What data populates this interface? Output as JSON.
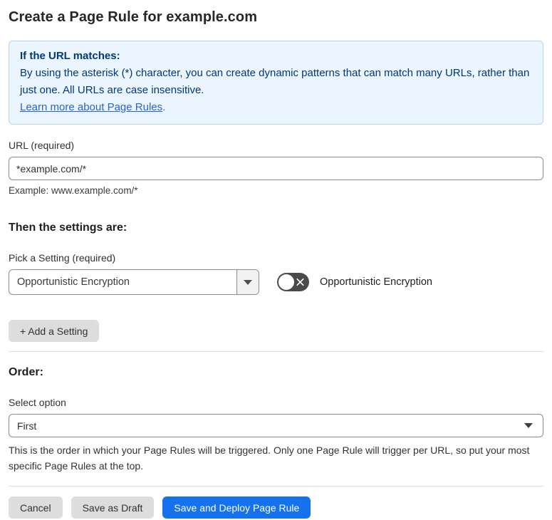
{
  "page": {
    "title": "Create a Page Rule for example.com"
  },
  "info_box": {
    "heading": "If the URL matches:",
    "body": "By using the asterisk (*) character, you can create dynamic patterns that can match many URLs, rather than just one. All URLs are case insensitive.",
    "link_label": "Learn more about Page Rules",
    "link_suffix": "."
  },
  "url_section": {
    "label": "URL (required)",
    "input_value": "*example.com/*",
    "example": "Example: www.example.com/*"
  },
  "settings_section": {
    "heading": "Then the settings are:",
    "pick_label": "Pick a Setting (required)",
    "selected_setting": "Opportunistic Encryption",
    "toggle_label": "Opportunistic Encryption",
    "toggle_state": "off",
    "add_button_label": "+ Add a Setting"
  },
  "order_section": {
    "heading": "Order:",
    "select_label": "Select option",
    "selected_option": "First",
    "helper": "This is the order in which your Page Rules will be triggered. Only one Page Rule will trigger per URL, so put your most specific Page Rules at the top."
  },
  "footer": {
    "cancel_label": "Cancel",
    "save_draft_label": "Save as Draft",
    "save_deploy_label": "Save and Deploy Page Rule"
  },
  "colors": {
    "info_bg": "#ebf5ff",
    "info_border": "#b7d5f3",
    "info_text": "#003682",
    "link_blue": "#2962d9",
    "primary_button_blue": "#1672ec",
    "toggle_off_gray": "#4a4a4a",
    "secondary_button_gray": "#dddddd"
  }
}
